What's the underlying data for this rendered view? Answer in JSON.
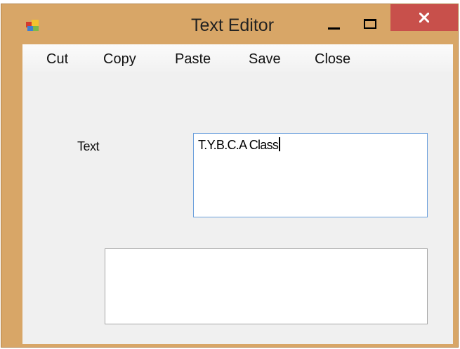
{
  "window": {
    "title": "Text Editor",
    "close_color": "#c8504b",
    "frame_color": "#d8a667"
  },
  "menu": {
    "items": [
      {
        "label": "Cut"
      },
      {
        "label": "Copy"
      },
      {
        "label": "Paste"
      },
      {
        "label": "Save"
      },
      {
        "label": "Close"
      }
    ]
  },
  "form": {
    "text_label": "Text",
    "text_value": "T.Y.B.C.A Class",
    "output_value": ""
  },
  "icons": {
    "app": "app-icon",
    "minimize": "minimize-icon",
    "maximize": "maximize-icon",
    "close": "close-icon"
  }
}
